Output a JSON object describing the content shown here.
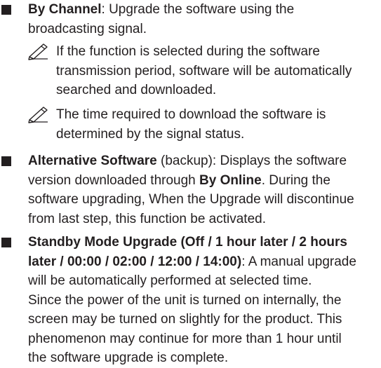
{
  "items": [
    {
      "term": "By Channel",
      "desc_lines": [
        ": Upgrade the software using the",
        "broadcasting signal."
      ],
      "notes": [
        {
          "icon": "note-pencil-icon",
          "lines": [
            "If the function is selected during the software",
            "transmission period, software will be automatically",
            "searched and downloaded."
          ]
        },
        {
          "icon": "note-pencil-icon",
          "lines": [
            "The time required to download the software is",
            "determined by the signal status."
          ]
        }
      ]
    },
    {
      "term": "Alternative Software",
      "line1_rest": " (backup): Displays the software",
      "line2_pre": "version downloaded through ",
      "line2_bold": "By Online",
      "line2_post": ". During the",
      "lines_rest": [
        "software upgrading, When the Upgrade will discontinue",
        "from last step, this function be activated."
      ]
    },
    {
      "term_lines": [
        "Standby Mode Upgrade (Off / 1 hour later / 2 hours",
        "later / 00:00 / 02:00 / 12:00 / 14:00)"
      ],
      "line2_post": ": A manual upgrade",
      "lines_rest": [
        "will be automatically performed at selected time.",
        "Since the power of the unit is turned on internally, the",
        "screen may be turned on slightly for the product. This",
        "phenomenon may continue for more than 1 hour until",
        "the software upgrade is complete."
      ]
    }
  ]
}
